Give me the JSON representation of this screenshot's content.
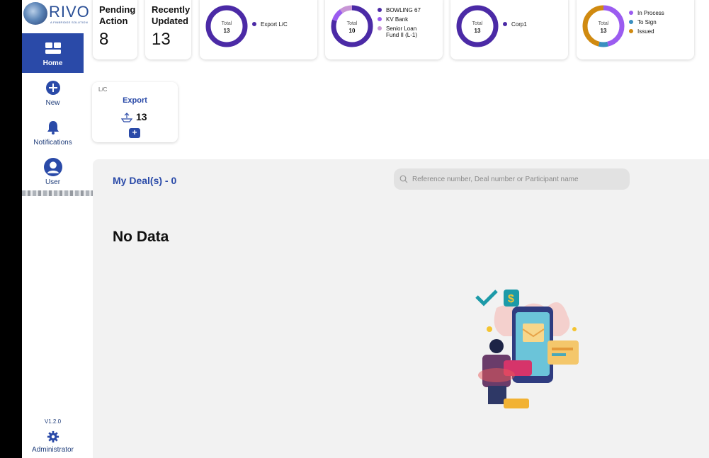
{
  "app": {
    "logo_text": "RIVO",
    "logo_subtitle": "A FINBRIDGE SOLUTION"
  },
  "sidebar": {
    "items": [
      {
        "label": "Home",
        "icon": "home-icon",
        "active": true
      },
      {
        "label": "New",
        "icon": "plus-circle-icon"
      },
      {
        "label": "Notifications",
        "icon": "bell-icon"
      },
      {
        "label": "User",
        "icon": "user-icon"
      }
    ],
    "version": "V1.2.0",
    "admin_label": "Administrator"
  },
  "stats": {
    "pending": {
      "title_line1": "Pending",
      "title_line2": "Action",
      "value": "8"
    },
    "recent": {
      "title_line1": "Recently",
      "title_line2": "Updated",
      "value": "13"
    }
  },
  "donuts": [
    {
      "total_label": "Total",
      "total": "13",
      "legend": [
        {
          "label": "Export L/C",
          "color": "#4b2aa6",
          "value": 13
        }
      ]
    },
    {
      "total_label": "Total",
      "total": "10",
      "legend": [
        {
          "label": "BOWLING 67",
          "color": "#4b2aa6",
          "value": 8
        },
        {
          "label": "KV Bank",
          "color": "#9b5cf0",
          "value": 1
        },
        {
          "label": "Senior Loan Fund II (L-1)",
          "color": "#c896d6",
          "value": 1
        }
      ]
    },
    {
      "total_label": "Total",
      "total": "13",
      "legend": [
        {
          "label": "Corp1",
          "color": "#4b2aa6",
          "value": 13
        }
      ]
    },
    {
      "total_label": "Total",
      "total": "13",
      "legend": [
        {
          "label": "In Process",
          "color": "#9b5cf0",
          "value": 6
        },
        {
          "label": "To Sign",
          "color": "#3a8fc0",
          "value": 1
        },
        {
          "label": "Issued",
          "color": "#d08a10",
          "value": 6
        }
      ]
    }
  ],
  "lc_card": {
    "tag": "L/C",
    "title": "Export",
    "count": "13",
    "add_label": "+"
  },
  "deals": {
    "title": "My Deal(s) - 0",
    "search_placeholder": "Reference number, Deal number or Participant name",
    "empty_text": "No Data"
  }
}
